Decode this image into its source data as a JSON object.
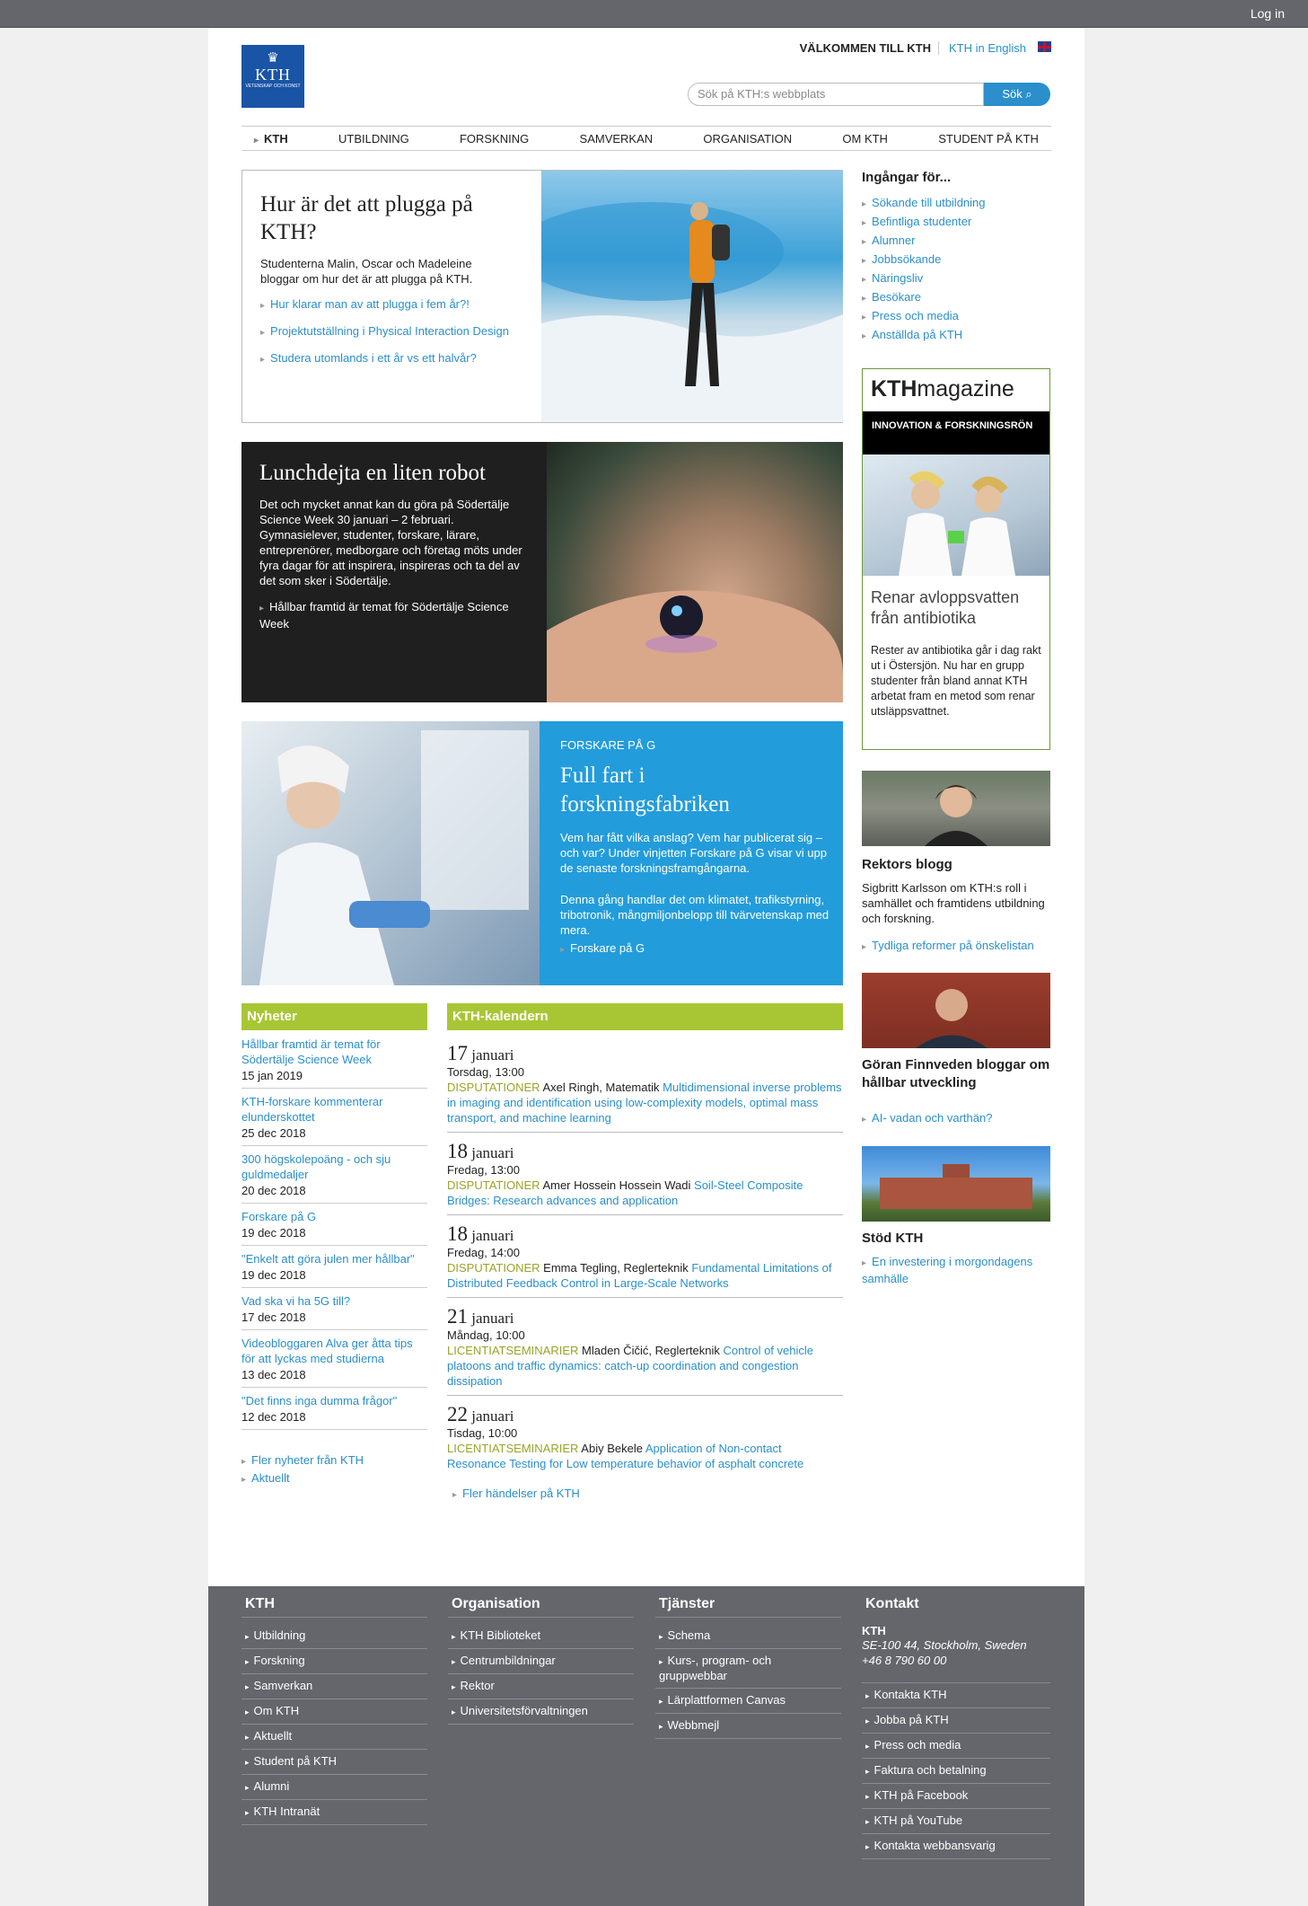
{
  "topbar": {
    "login": "Log in"
  },
  "header": {
    "logo_text": "KTH",
    "logo_sub": "VETENSKAP OCH KONST",
    "welcome": "VÄLKOMMEN TILL KTH",
    "english": "KTH in English",
    "search_placeholder": "Sök på KTH:s webbplats",
    "search_button": "Sök"
  },
  "nav": [
    "KTH",
    "UTBILDNING",
    "FORSKNING",
    "SAMVERKAN",
    "ORGANISATION",
    "OM KTH",
    "STUDENT PÅ KTH"
  ],
  "feature1": {
    "title": "Hur är det att plugga på KTH?",
    "body": "Studenterna Malin, Oscar och Madeleine bloggar om hur det är att plugga på KTH.",
    "links": [
      "Hur klarar man av att plugga i fem år?!",
      "Projektutställning i Physical Interaction Design",
      "Studera utomlands i ett år vs ett halvår?"
    ]
  },
  "feature2": {
    "title": "Lunchdejta en liten robot",
    "body": "Det och mycket annat kan du göra på Södertälje Science Week 30 januari – 2 februari. Gymnasielever, studenter, forskare, lärare, entreprenörer, medborgare och företag möts under fyra dagar för att inspirera, inspireras och ta del av det som sker i Södertälje.",
    "link": "Hållbar framtid är temat för Södertälje Science Week"
  },
  "feature3": {
    "kicker": "FORSKARE PÅ G",
    "title": "Full fart i forskningsfabriken",
    "body1": "Vem har fått vilka anslag? Vem har publicerat sig – och var? Under vinjetten Forskare på G visar vi upp de senaste forskningsframgångarna.",
    "body2": "Denna gång handlar det om klimatet, trafikstyrning, tribotronik, mångmiljonbelopp till tvärvetenskap med mera.",
    "link": "Forskare på G"
  },
  "sidebar": {
    "title": "Ingångar för...",
    "links": [
      "Sökande till utbildning",
      "Befintliga studenter",
      "Alumner",
      "Jobbsökande",
      "Näringsliv",
      "Besökare",
      "Press och media",
      "Anställda på KTH"
    ]
  },
  "magazine": {
    "logo_bold": "KTH",
    "logo_light": "magazine",
    "band": "INNOVATION & FORSKNINGSRÖN",
    "title": "Renar avloppsvatten från antibiotika",
    "body": "Rester av antibiotika går i dag rakt ut i Östersjön. Nu har en grupp studenter från bland annat KTH arbetat fram en metod som renar utsläppsvattnet."
  },
  "rektor": {
    "title": "Rektors blogg",
    "body": "Sigbritt Karlsson om KTH:s roll i samhället och framtidens utbildning och forskning.",
    "link": "Tydliga reformer på önskelistan"
  },
  "goran": {
    "title": "Göran Finnveden bloggar om hållbar utveckling",
    "link": "AI- vadan och varthän?"
  },
  "stod": {
    "title": "Stöd KTH",
    "link": "En investering i morgondagens samhälle"
  },
  "news": {
    "title": "Nyheter",
    "items": [
      {
        "t": "Hållbar framtid är temat för Södertälje Science Week",
        "d": "15 jan 2019"
      },
      {
        "t": "KTH-forskare kommenterar elunderskottet",
        "d": "25 dec 2018"
      },
      {
        "t": "300 högskolepoäng - och sju guldmedaljer",
        "d": "20 dec 2018"
      },
      {
        "t": "Forskare på G",
        "d": "19 dec 2018"
      },
      {
        "t": "\"Enkelt att göra julen mer hållbar\"",
        "d": "19 dec 2018"
      },
      {
        "t": "Vad ska vi ha 5G till?",
        "d": "17 dec 2018"
      },
      {
        "t": "Videobloggaren Alva ger åtta tips för att lyckas med studierna",
        "d": "13 dec 2018"
      },
      {
        "t": "\"Det finns inga dumma frågor\"",
        "d": "12 dec 2018"
      }
    ],
    "more": [
      "Fler nyheter från KTH",
      "Aktuellt"
    ]
  },
  "calendar": {
    "title": "KTH-kalendern",
    "events": [
      {
        "day": "17",
        "month": "januari",
        "time": "Torsdag, 13:00",
        "cat": "DISPUTATIONER",
        "who": "Axel Ringh, Matematik",
        "link": "Multidimensional inverse problems in imaging and identification using low-complexity models, optimal mass transport, and machine learning"
      },
      {
        "day": "18",
        "month": "januari",
        "time": "Fredag, 13:00",
        "cat": "DISPUTATIONER",
        "who": "Amer Hossein Hossein Wadi",
        "link": "Soil-Steel Composite Bridges: Research advances and application"
      },
      {
        "day": "18",
        "month": "januari",
        "time": "Fredag, 14:00",
        "cat": "DISPUTATIONER",
        "who": "Emma Tegling, Reglerteknik",
        "link": "Fundamental Limitations of Distributed Feedback Control in Large-Scale Networks"
      },
      {
        "day": "21",
        "month": "januari",
        "time": "Måndag, 10:00",
        "cat": "LICENTIATSEMINARIER",
        "who": "Mladen Čičić, Reglerteknik",
        "link": "Control of vehicle platoons and traffic dynamics: catch-up coordination and congestion dissipation"
      },
      {
        "day": "22",
        "month": "januari",
        "time": "Tisdag, 10:00",
        "cat": "LICENTIATSEMINARIER",
        "who": "Abiy Bekele",
        "link": "Application of Non-contact Resonance Testing for Low temperature behavior of asphalt concrete"
      }
    ],
    "more": "Fler händelser på KTH"
  },
  "footer": {
    "kth": {
      "title": "KTH",
      "items": [
        "Utbildning",
        "Forskning",
        "Samverkan",
        "Om KTH",
        "Aktuellt",
        "Student på KTH",
        "Alumni",
        "KTH Intranät"
      ]
    },
    "org": {
      "title": "Organisation",
      "items": [
        "KTH Biblioteket",
        "Centrumbildningar",
        "Rektor",
        "Universitetsförvaltningen"
      ]
    },
    "tjanster": {
      "title": "Tjänster",
      "items": [
        "Schema",
        "Kurs-, program- och gruppwebbar",
        "Lärplattformen Canvas",
        "Webbmejl"
      ]
    },
    "kontakt": {
      "title": "Kontakt",
      "name": "KTH",
      "addr": "SE-100 44, Stockholm, Sweden",
      "phone": "+46 8 790 60 00",
      "items": [
        "Kontakta KTH",
        "Jobba på KTH",
        "Press och media",
        "Faktura och betalning",
        "KTH på Facebook",
        "KTH på YouTube",
        "Kontakta webbansvarig"
      ]
    }
  }
}
